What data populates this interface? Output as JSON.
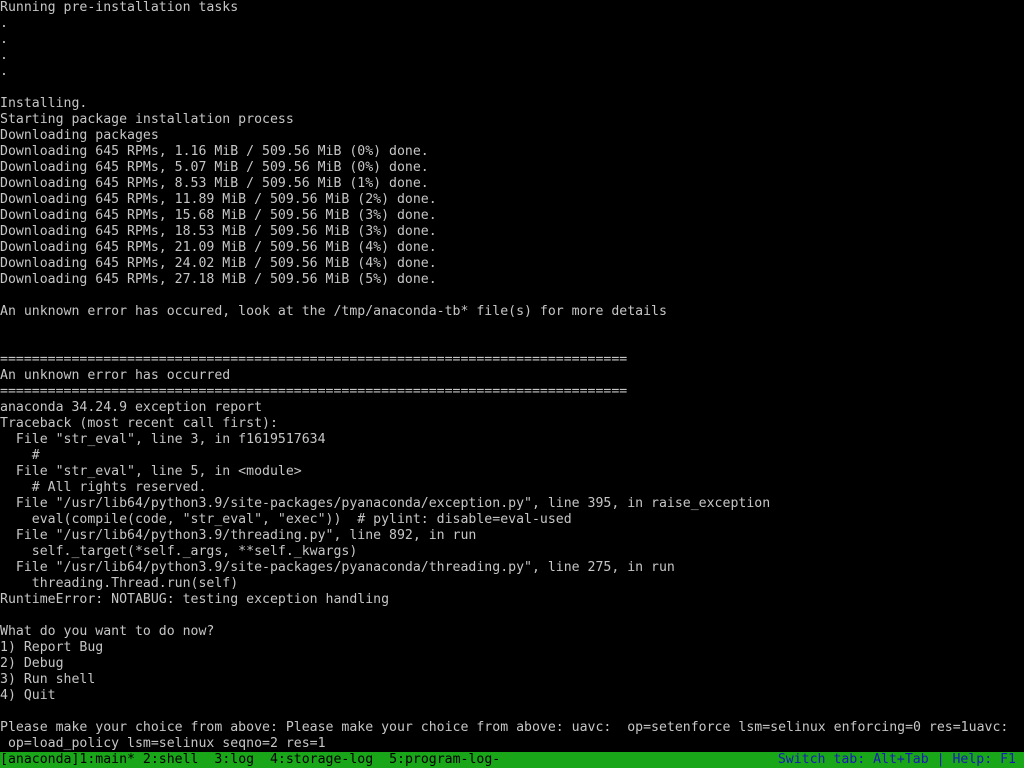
{
  "console": {
    "lines": [
      "Running pre-installation tasks",
      ".",
      ".",
      ".",
      ".",
      "",
      "Installing.",
      "Starting package installation process",
      "Downloading packages",
      "Downloading 645 RPMs, 1.16 MiB / 509.56 MiB (0%) done.",
      "Downloading 645 RPMs, 5.07 MiB / 509.56 MiB (0%) done.",
      "Downloading 645 RPMs, 8.53 MiB / 509.56 MiB (1%) done.",
      "Downloading 645 RPMs, 11.89 MiB / 509.56 MiB (2%) done.",
      "Downloading 645 RPMs, 15.68 MiB / 509.56 MiB (3%) done.",
      "Downloading 645 RPMs, 18.53 MiB / 509.56 MiB (3%) done.",
      "Downloading 645 RPMs, 21.09 MiB / 509.56 MiB (4%) done.",
      "Downloading 645 RPMs, 24.02 MiB / 509.56 MiB (4%) done.",
      "Downloading 645 RPMs, 27.18 MiB / 509.56 MiB (5%) done.",
      "",
      "An unknown error has occured, look at the /tmp/anaconda-tb* file(s) for more details",
      "",
      "",
      "===============================================================================",
      "An unknown error has occurred",
      "===============================================================================",
      "anaconda 34.24.9 exception report",
      "Traceback (most recent call first):",
      "  File \"str_eval\", line 3, in f1619517634",
      "    #",
      "  File \"str_eval\", line 5, in <module>",
      "    # All rights reserved.",
      "  File \"/usr/lib64/python3.9/site-packages/pyanaconda/exception.py\", line 395, in raise_exception",
      "    eval(compile(code, \"str_eval\", \"exec\"))  # pylint: disable=eval-used",
      "  File \"/usr/lib64/python3.9/threading.py\", line 892, in run",
      "    self._target(*self._args, **self._kwargs)",
      "  File \"/usr/lib64/python3.9/site-packages/pyanaconda/threading.py\", line 275, in run",
      "    threading.Thread.run(self)",
      "RuntimeError: NOTABUG: testing exception handling",
      "",
      "What do you want to do now?",
      "1) Report Bug",
      "2) Debug",
      "3) Run shell",
      "4) Quit",
      "",
      "Please make your choice from above: Please make your choice from above: uavc:  op=setenforce lsm=selinux enforcing=0 res=1uavc:",
      " op=load_policy lsm=selinux seqno=2 res=1"
    ]
  },
  "status_bar": {
    "windows": [
      "[anaconda]1:main*",
      " 2:shell ",
      " 3:log ",
      " 4:storage-log ",
      " 5:program-log-"
    ],
    "help_text": "Switch tab: Alt+Tab | Help: F1",
    "colors": {
      "background": "#19a619",
      "window_text": "#000000",
      "help_text": "#1a1ab8"
    }
  }
}
